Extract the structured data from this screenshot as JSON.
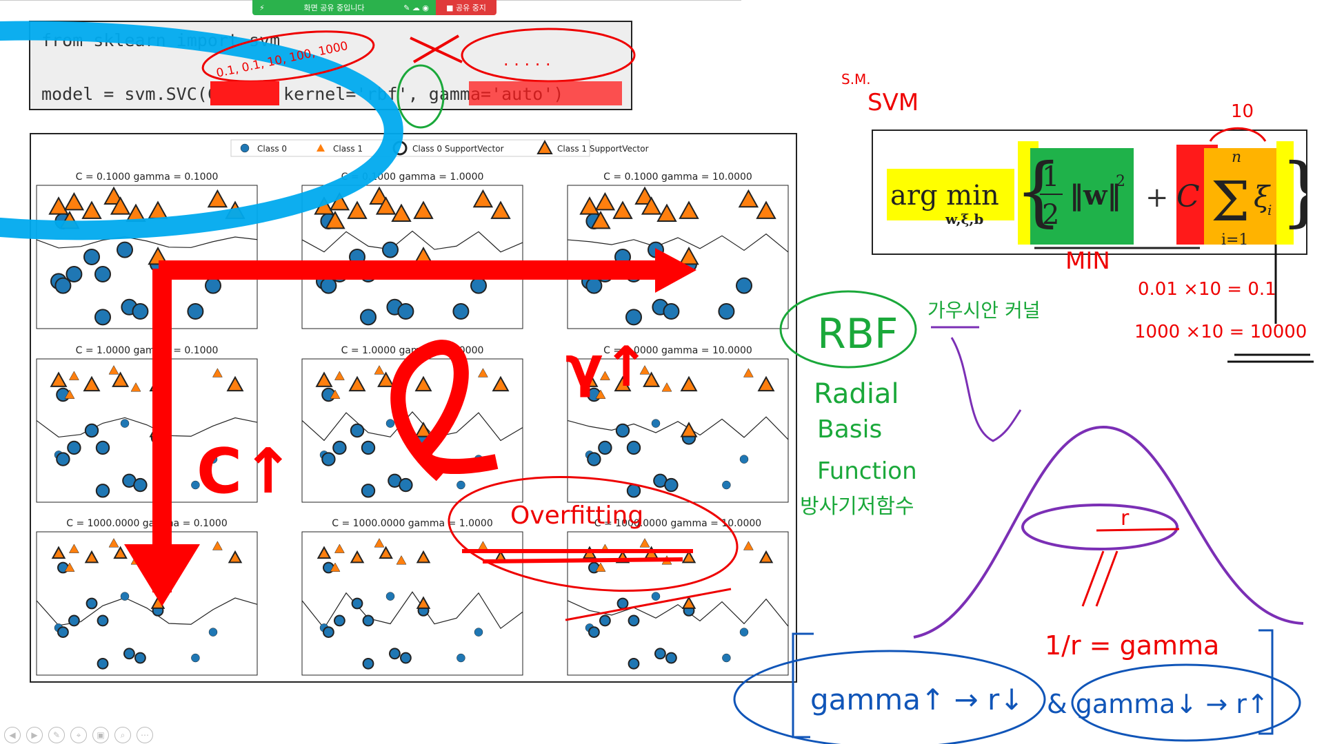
{
  "share_bar": {
    "status_label": "화면 공유 중입니다",
    "stop_label": "공유 중지"
  },
  "code": {
    "line1": "from sklearn import svm",
    "line2_prefix": "model = svm.SVC(C=",
    "line2_kernel": ", kernel='rbf', ",
    "line2_gamma": "gamma='auto')"
  },
  "legend": {
    "items": [
      "Class 0",
      "Class 1",
      "Class 0 SupportVector",
      "Class 1 SupportVector"
    ]
  },
  "colors": {
    "class0": "#1f77b4",
    "class1": "#ff7f0e",
    "ink_red": "#ff0000",
    "ink_blue": "#00aaee",
    "ink_green": "#1aa83a",
    "ink_purple": "#7b2fb5",
    "ink_darkblue": "#1055b8"
  },
  "chart_data": {
    "type": "scatter",
    "panels": [
      {
        "title": "C = 0.1000 gamma = 0.1000"
      },
      {
        "title": "C = 0.1000 gamma = 1.0000"
      },
      {
        "title": "C = 0.1000 gamma = 10.0000"
      },
      {
        "title": "C = 1.0000 gamma = 0.1000"
      },
      {
        "title": "C = 1.0000 gamma = 1.0000"
      },
      {
        "title": "C = 1.0000 gamma = 10.0000"
      },
      {
        "title": "C = 1000.0000 gamma = 0.1000"
      },
      {
        "title": "C = 1000.0000 gamma = 1.0000"
      },
      {
        "title": "C = 1000.0000 gamma = 10.0000"
      }
    ],
    "class0_points": [
      [
        0.12,
        0.25
      ],
      [
        0.25,
        0.5
      ],
      [
        0.4,
        0.45
      ],
      [
        0.17,
        0.62
      ],
      [
        0.3,
        0.62
      ],
      [
        0.1,
        0.67
      ],
      [
        0.12,
        0.7
      ],
      [
        0.55,
        0.55
      ],
      [
        0.8,
        0.7
      ],
      [
        0.42,
        0.85
      ],
      [
        0.47,
        0.88
      ],
      [
        0.72,
        0.88
      ],
      [
        0.3,
        0.92
      ]
    ],
    "class1_points": [
      [
        0.1,
        0.15
      ],
      [
        0.17,
        0.12
      ],
      [
        0.25,
        0.18
      ],
      [
        0.35,
        0.08
      ],
      [
        0.38,
        0.15
      ],
      [
        0.45,
        0.2
      ],
      [
        0.55,
        0.18
      ],
      [
        0.82,
        0.1
      ],
      [
        0.9,
        0.18
      ],
      [
        0.15,
        0.25
      ],
      [
        0.55,
        0.5
      ]
    ]
  },
  "formula": {
    "prefix": "arg min",
    "subscript": "w,ξ,b",
    "half": "1",
    "half_den": "2",
    "norm": "‖w‖",
    "power": "2",
    "plus": "+",
    "C": "C",
    "sum_top": "n",
    "sum_sym": "Σ",
    "sum_bottom": "i=1",
    "xi": "ξ",
    "xi_sub": "i"
  },
  "annotations": {
    "sm": "S.M.",
    "svm": "SVM",
    "ten_top": "10",
    "c_values": "0.1, 0.1, 10, 100, 1000",
    "dots": ". . . . .",
    "min_label": "MIN",
    "calc1": "0.01 ×10 = 0.1",
    "calc2": "1000 ×10 = 10000",
    "rbf": "RBF",
    "rbf_ko": "가우시안 커널",
    "radial": "Radial",
    "basis": "Basis",
    "function": "Function",
    "rbf_ko2": "방사기저함수",
    "c_up": "C↑",
    "gamma_up_overlay": "γ↑",
    "overfitting": "Overfitting",
    "r_label": "r",
    "inv_gamma": "1/r = gamma",
    "gamma_up": "gamma↑ → r↓",
    "gamma_down": "& gamma↓ → r↑"
  },
  "bottom_toolbar": [
    "prev",
    "next",
    "pen",
    "pointer",
    "screen",
    "zoom",
    "more"
  ]
}
